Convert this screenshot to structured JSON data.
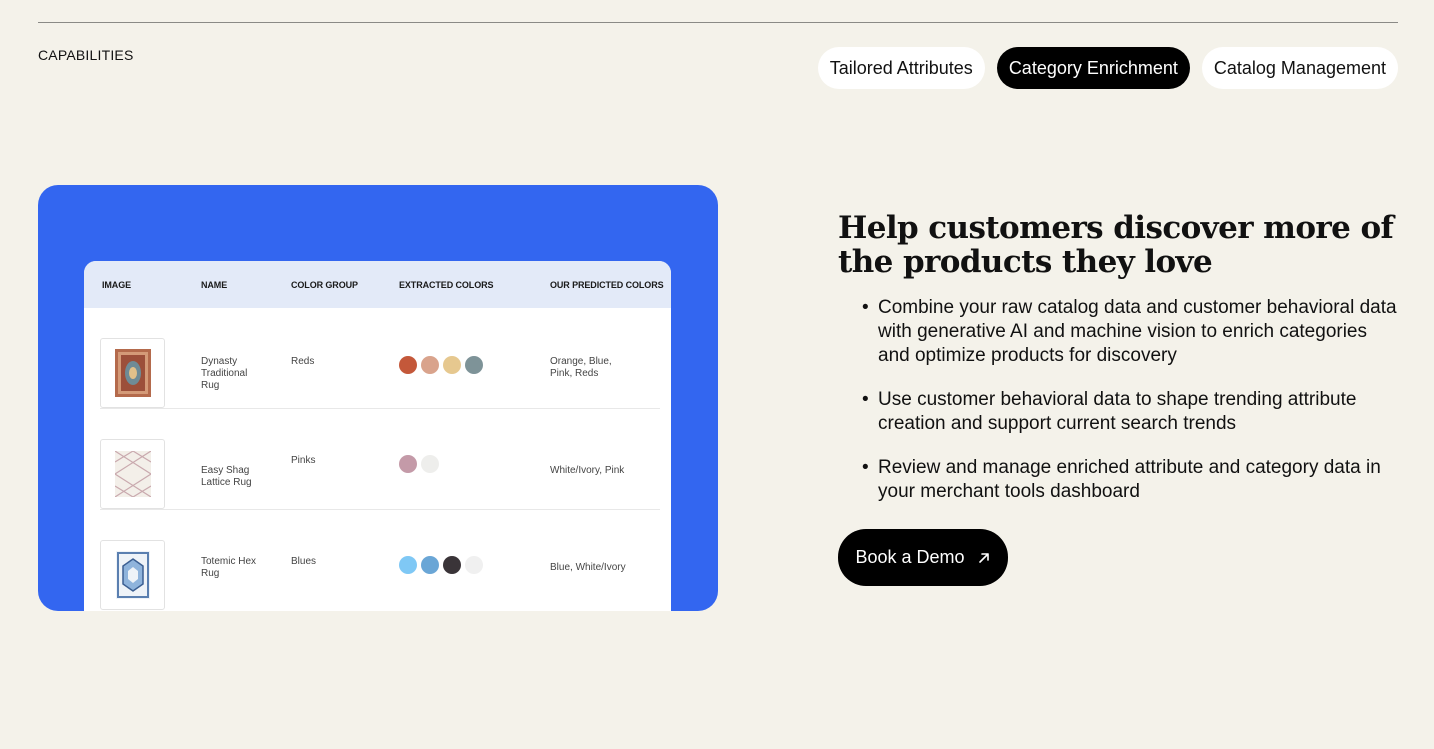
{
  "section": {
    "label": "CAPABILITIES"
  },
  "tabs": [
    {
      "label": "Tailored Attributes",
      "active": false
    },
    {
      "label": "Category Enrichment",
      "active": true
    },
    {
      "label": "Catalog Management",
      "active": false
    }
  ],
  "table": {
    "columns": [
      "IMAGE",
      "NAME",
      "COLOR GROUP",
      "EXTRACTED COLORS",
      "OUR PREDICTED COLORS"
    ],
    "rows": [
      {
        "name": "Dynasty Traditional Rug",
        "color_group": "Reds",
        "swatches": [
          "#c4583a",
          "#d9a38c",
          "#e6c88f",
          "#7e9398"
        ],
        "predicted": "Orange, Blue, Pink, Reds",
        "thumb_icon": "traditional-rug-icon"
      },
      {
        "name": "Easy Shag Lattice Rug",
        "color_group": "Pinks",
        "swatches": [
          "#c49aa8",
          "#eeeeec"
        ],
        "predicted": "White/Ivory, Pink",
        "thumb_icon": "lattice-rug-icon"
      },
      {
        "name": "Totemic Hex Rug",
        "color_group": "Blues",
        "swatches": [
          "#7fc8f5",
          "#6aa6d6",
          "#3a3438",
          "#f0f0f0"
        ],
        "predicted": "Blue, White/Ivory",
        "thumb_icon": "hex-rug-icon"
      }
    ]
  },
  "content": {
    "headline": "Help customers discover more of the products they love",
    "bullets": [
      "Combine your raw catalog data and customer behavioral data with generative AI and machine vision to enrich categories and optimize products for discovery",
      "Use customer behavioral data to shape trending attribute creation and support current search trends",
      "Review and manage enriched attribute and category data in your merchant tools dashboard"
    ],
    "cta_label": "Book a Demo",
    "cta_icon": "arrow-up-right-icon"
  },
  "colors": {
    "background": "#f4f2ea",
    "card": "#3366f0",
    "table_header": "#e3eaf8",
    "active_tab": "#000000"
  }
}
